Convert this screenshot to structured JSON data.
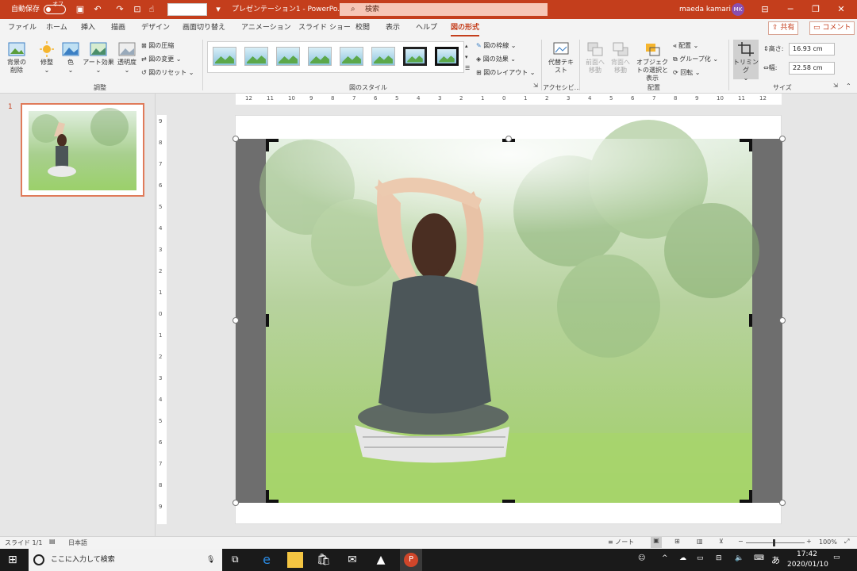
{
  "titlebar": {
    "autosave_label": "自動保存",
    "autosave_state": "オフ",
    "doc_title": "プレゼンテーション1 - PowerPo...",
    "search_placeholder": "検索",
    "user_name": "maeda kamari",
    "user_initials": "MK"
  },
  "tabs": [
    "ファイル",
    "ホーム",
    "挿入",
    "描画",
    "デザイン",
    "画面切り替え",
    "アニメーション",
    "スライド ショー",
    "校閲",
    "表示",
    "ヘルプ",
    "図の形式"
  ],
  "active_tab": "図の形式",
  "share_label": "共有",
  "comment_label": "コメント",
  "ribbon": {
    "adjust": {
      "remove_bg": "背景の削除",
      "corrections": "修整",
      "color": "色",
      "art_effects": "アート効果",
      "transparency": "透明度",
      "compress": "図の圧縮",
      "change": "図の変更",
      "reset": "図のリセット",
      "group_label": "調整"
    },
    "styles": {
      "border": "図の枠線",
      "effects": "図の効果",
      "layout": "図のレイアウト",
      "group_label": "図のスタイル"
    },
    "accessibility": {
      "alt_text": "代替テキスト",
      "group_label": "アクセシビ..."
    },
    "arrange": {
      "bring_forward": "前面へ移動",
      "send_backward": "背面へ移動",
      "selection_pane": "オブジェクトの選択と表示",
      "align": "配置",
      "group": "グループ化",
      "rotate": "回転",
      "group_label": "配置"
    },
    "size": {
      "crop": "トリミング",
      "height_label": "高さ:",
      "height_value": "16.93 cm",
      "width_label": "幅:",
      "width_value": "22.58 cm",
      "group_label": "サイズ"
    }
  },
  "slide_number": "1",
  "ruler_h": [
    "12",
    "11",
    "10",
    "9",
    "8",
    "7",
    "6",
    "5",
    "4",
    "3",
    "2",
    "1",
    "0",
    "1",
    "2",
    "3",
    "4",
    "5",
    "6",
    "7",
    "8",
    "9",
    "10",
    "11",
    "12"
  ],
  "ruler_v": [
    "9",
    "8",
    "7",
    "6",
    "5",
    "4",
    "3",
    "2",
    "1",
    "0",
    "1",
    "2",
    "3",
    "4",
    "5",
    "6",
    "7",
    "8",
    "9"
  ],
  "status": {
    "slide_info": "スライド 1/1",
    "language": "日本語",
    "notes": "ノート",
    "zoom": "100%"
  },
  "taskbar": {
    "search_placeholder": "ここに入力して検索",
    "ime": "あ",
    "time": "17:42",
    "date": "2020/01/10"
  }
}
